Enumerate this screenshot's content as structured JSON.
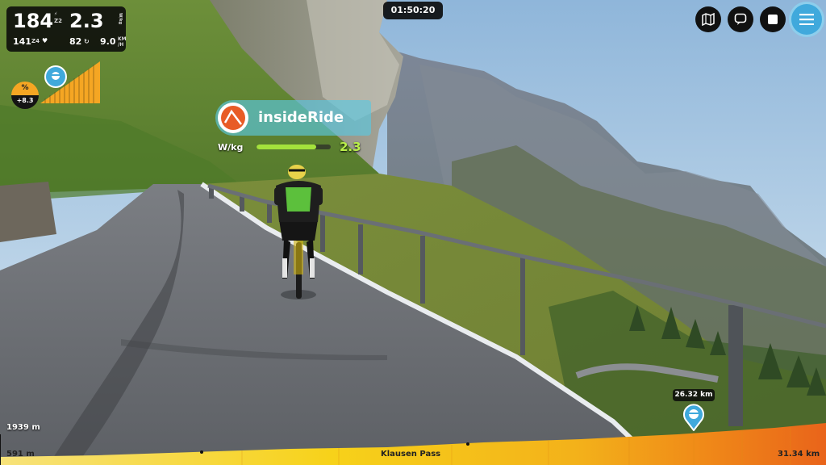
{
  "stats": {
    "power": "184",
    "power_zone_top": "Z2",
    "wkg": "2.3",
    "wkg_unit": "W/kg",
    "heart_rate": "141",
    "hr_zone": "Z4",
    "cadence": "82",
    "speed": "9.0",
    "speed_unit_top": "KM",
    "speed_unit_bottom": "/H"
  },
  "timer": "01:50:20",
  "top_controls": {
    "icons": [
      "map-icon",
      "chat-icon",
      "stop-icon",
      "menu-icon"
    ]
  },
  "grade": {
    "symbol": "%",
    "value": "+8.3"
  },
  "sponsor": {
    "brand_text": "insideRide",
    "brand_color": "#e85c26",
    "wkg_label": "W/kg",
    "wkg_value": "2.3",
    "wkg_fill_fraction": 0.8
  },
  "route": {
    "distance_bubble": "26.32 km",
    "elevation_max": "1939 m",
    "elevation_min": "591 m",
    "segment_name": "Klausen Pass",
    "total_distance": "31.34 km"
  },
  "colors": {
    "accent_blue": "#40a9dc",
    "wkg_green": "#a4e23c",
    "profile_yellow": "#f7d21a",
    "profile_orange": "#f08a18",
    "grade_orange": "#f5a623"
  }
}
